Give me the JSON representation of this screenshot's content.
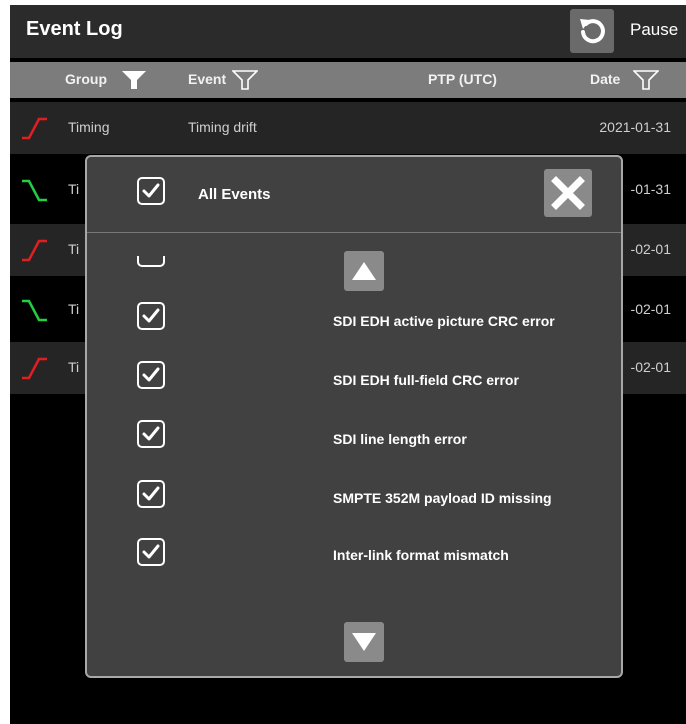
{
  "window": {
    "title": "Event Log",
    "pause_label": "Pause"
  },
  "table": {
    "headers": {
      "group": "Group",
      "event": "Event",
      "ptp": "PTP (UTC)",
      "date": "Date"
    },
    "rows": [
      {
        "trend": "rising-edge-icon",
        "color": "#e02020",
        "group": "Timing",
        "event": "Timing drift",
        "date": "2021-01-31"
      },
      {
        "trend": "falling-edge-icon",
        "color": "#20d040",
        "group": "Ti",
        "event": "",
        "date": "-01-31"
      },
      {
        "trend": "rising-edge-icon",
        "color": "#e02020",
        "group": "Ti",
        "event": "",
        "date": "-02-01"
      },
      {
        "trend": "falling-edge-icon",
        "color": "#20d040",
        "group": "Ti",
        "event": "",
        "date": "-02-01"
      },
      {
        "trend": "rising-edge-icon",
        "color": "#e02020",
        "group": "Ti",
        "event": "",
        "date": "-02-01"
      }
    ]
  },
  "filter_dialog": {
    "all_events_label": "All Events",
    "all_events_checked": true,
    "events": [
      {
        "label": "SDI EDH active picture CRC error",
        "checked": true
      },
      {
        "label": "SDI EDH full-field CRC error",
        "checked": true
      },
      {
        "label": "SDI line length error",
        "checked": true
      },
      {
        "label": "SMPTE 352M payload ID missing",
        "checked": true
      },
      {
        "label": "Inter-link format mismatch",
        "checked": true
      }
    ]
  },
  "colors": {
    "background": "#000000",
    "title_bar": "#2b2b2b",
    "header": "#7c7c7c",
    "dialog": "#414141",
    "rising": "#e02020",
    "falling": "#20d040"
  }
}
